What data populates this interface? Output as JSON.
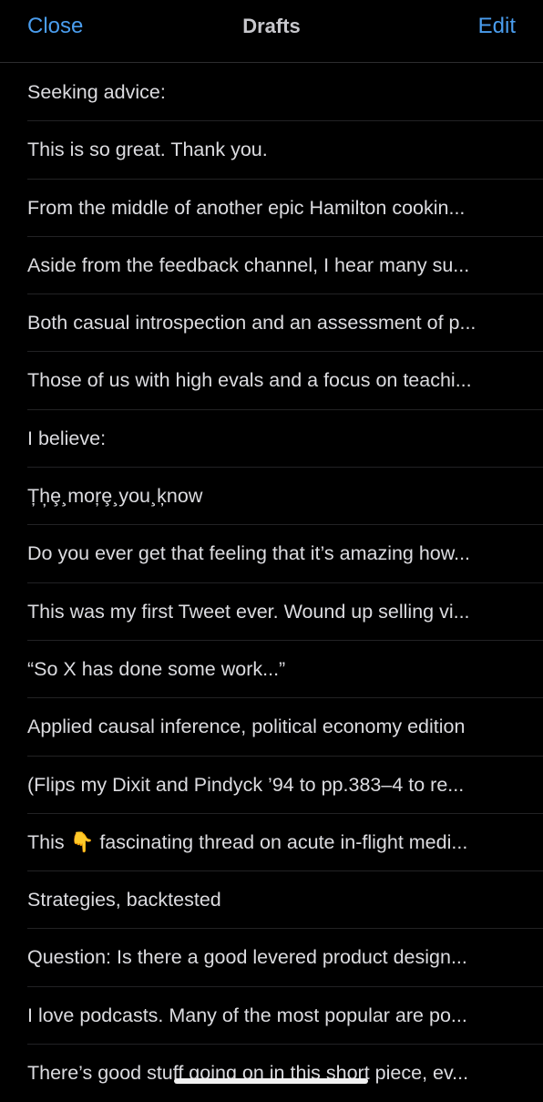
{
  "nav": {
    "close_label": "Close",
    "title": "Drafts",
    "edit_label": "Edit"
  },
  "drafts": [
    "Seeking advice:",
    "This is so great. Thank you.",
    "From the middle of another epic Hamilton cookin...",
    "Aside from the feedback channel, I hear many su...",
    "Both casual introspection and an assessment of p...",
    "Those of us with high evals and a focus on teachi...",
    "I believe:",
    "Țh̦ȩ¸moŗȩ¸you¸ķnow",
    "Do you ever get that feeling that it’s amazing how...",
    "This was my first Tweet ever. Wound up selling vi...",
    "“So X has done some work...”",
    "Applied causal inference, political economy edition",
    "(Flips my Dixit and Pindyck ’94 to pp.383–4 to re...",
    "This 👇 fascinating thread on acute in-flight medi...",
    "Strategies, backtested",
    "Question: Is there a good levered product design...",
    "I love podcasts. Many of the most popular are po...",
    "There’s good stuff going on in this short piece, ev..."
  ],
  "colors": {
    "background": "#000000",
    "accent": "#4a9dee",
    "text": "#dcdce0",
    "separator": "#222224"
  }
}
